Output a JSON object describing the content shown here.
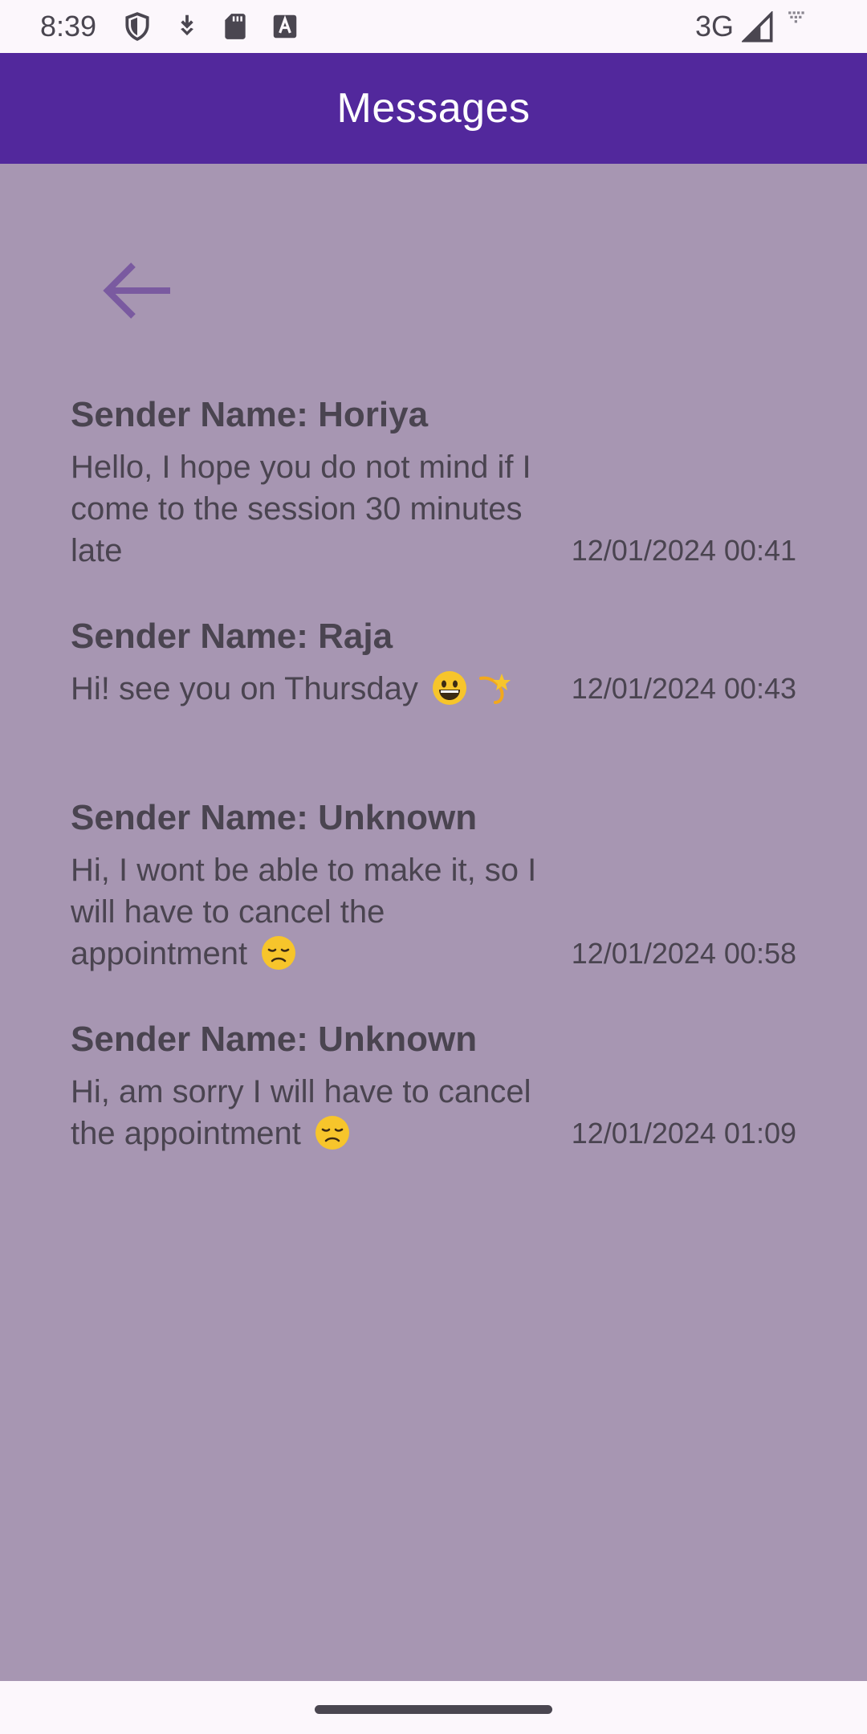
{
  "status_bar": {
    "time": "8:39",
    "network": "3G",
    "icons": [
      "shield-icon",
      "download-icon",
      "sd-card-icon",
      "keyboard-a-icon",
      "signal-icon",
      "wifi-off-icon"
    ]
  },
  "app_bar": {
    "title": "Messages",
    "color": "#52289c"
  },
  "content": {
    "background": "#a796b2",
    "back_icon": "arrow-left-icon",
    "messages": [
      {
        "sender": "Sender Name: Horiya",
        "text": "Hello, I hope you do not mind if I come to the session 30 minutes late",
        "timestamp": "12/01/2024 00:41"
      },
      {
        "sender": "Sender Name: Raja",
        "text": "Hi! see you on Thursday",
        "emoji": [
          "grinning-face-emoji",
          "dizzy-emoji"
        ],
        "timestamp": "12/01/2024 00:43"
      },
      {
        "sender": "Sender Name: Unknown",
        "text": "Hi, I wont be able to make it, so I will have to cancel the appointment",
        "emoji": [
          "disappointed-face-emoji"
        ],
        "timestamp": "12/01/2024 00:58"
      },
      {
        "sender": "Sender Name: Unknown",
        "text": "Hi, am sorry I will have to cancel the appointment",
        "emoji": [
          "disappointed-face-emoji"
        ],
        "timestamp": "12/01/2024 01:09"
      }
    ]
  }
}
